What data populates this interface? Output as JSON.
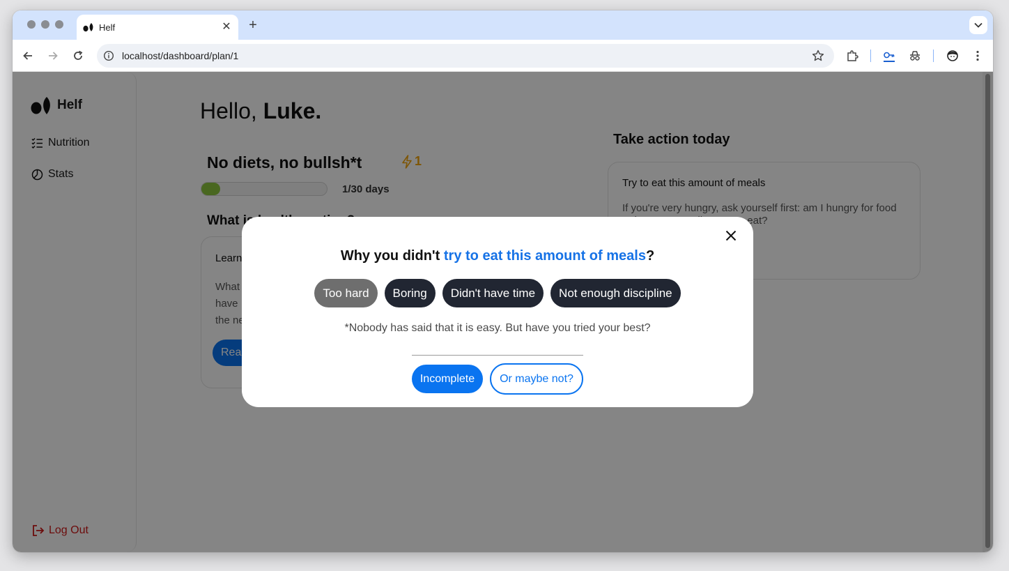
{
  "browser": {
    "tab_title": "Helf",
    "url": "localhost/dashboard/plan/1"
  },
  "sidebar": {
    "brand": "Helf",
    "items": [
      {
        "label": "Nutrition",
        "icon": "checklist-icon"
      },
      {
        "label": "Stats",
        "icon": "pie-chart-icon"
      }
    ],
    "logout_label": "Log Out"
  },
  "main": {
    "greeting_prefix": "Hello,",
    "user_name": "Luke.",
    "plan_title": "No diets, no bullsh*t",
    "streak_count": "1",
    "progress": {
      "label": "1/30 days",
      "value": 1,
      "total": 30
    },
    "section_heading": "What is healthy eating?",
    "learn_card": {
      "title": "Learn",
      "text": "What",
      "text2": "have",
      "text3": "the ne",
      "button_label": "Read"
    },
    "action": {
      "heading": "Take action today",
      "card_title": "Try to eat this amount of meals",
      "card_text": "If you're very hungry, ask yourself first: am I hungry for food or because I really want to eat?"
    }
  },
  "modal": {
    "question_prefix": "Why you didn't",
    "question_highlight": "try to eat this amount of meals",
    "question_suffix": "?",
    "reasons": [
      {
        "label": "Too hard",
        "selected": true
      },
      {
        "label": "Boring",
        "selected": false
      },
      {
        "label": "Didn't have time",
        "selected": false
      },
      {
        "label": "Not enough discipline",
        "selected": false
      }
    ],
    "note": "*Nobody has said that it is easy. But have you tried your best?",
    "primary_button": "Incomplete",
    "secondary_button": "Or maybe not?"
  },
  "colors": {
    "accent": "#0a74f0",
    "streak": "#f1a40a",
    "progress_fill": "#8dc63f",
    "logout": "#d01818",
    "chip": "#212632",
    "chip_selected": "#6e6e6e"
  }
}
